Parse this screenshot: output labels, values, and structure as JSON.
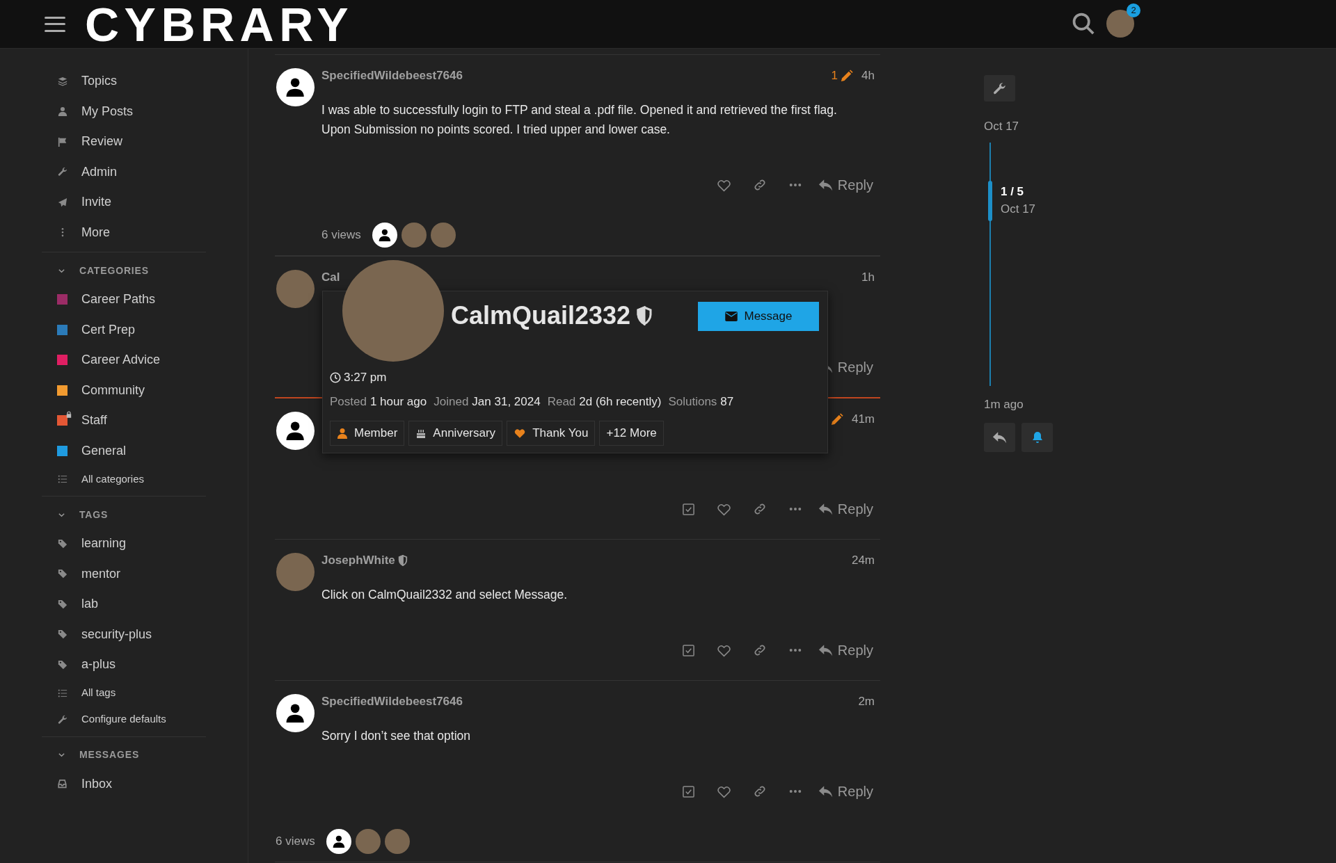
{
  "header": {
    "logo": "CYBRARY",
    "notification_count": "2"
  },
  "sidebar": {
    "nav": [
      {
        "label": "Topics",
        "kind": "topics"
      },
      {
        "label": "My Posts",
        "kind": "user"
      },
      {
        "label": "Review",
        "kind": "flag"
      },
      {
        "label": "Admin",
        "kind": "wrench"
      },
      {
        "label": "Invite",
        "kind": "send"
      },
      {
        "label": "More",
        "kind": "dots"
      }
    ],
    "sections": [
      {
        "title": "CATEGORIES",
        "expanded": true,
        "items": [
          {
            "label": "Career Paths",
            "kind": "category",
            "color": "#9b2c66",
            "locked": false
          },
          {
            "label": "Cert Prep",
            "kind": "category",
            "color": "#2b7bb9",
            "locked": false
          },
          {
            "label": "Career Advice",
            "kind": "category",
            "color": "#e01f63",
            "locked": false
          },
          {
            "label": "Community",
            "kind": "category",
            "color": "#f29b30",
            "locked": false
          },
          {
            "label": "Staff",
            "kind": "category",
            "color": "#e45735",
            "locked": true
          },
          {
            "label": "General",
            "kind": "category",
            "color": "#1f9be0",
            "locked": false
          },
          {
            "label": "All categories",
            "kind": "listing"
          }
        ]
      },
      {
        "title": "TAGS",
        "expanded": true,
        "items": [
          {
            "label": "learning",
            "kind": "tag"
          },
          {
            "label": "mentor",
            "kind": "tag"
          },
          {
            "label": "lab",
            "kind": "tag"
          },
          {
            "label": "security-plus",
            "kind": "tag"
          },
          {
            "label": "a-plus",
            "kind": "tag"
          },
          {
            "label": "All tags",
            "kind": "listing"
          },
          {
            "label": "Configure defaults",
            "kind": "settings"
          }
        ]
      },
      {
        "title": "MESSAGES",
        "expanded": true,
        "items": [
          {
            "label": "Inbox",
            "kind": "inbox"
          }
        ]
      }
    ]
  },
  "stream": [
    {
      "kind": "post",
      "author": "SpecifiedWildebeest7646",
      "has_photo": false,
      "moderator": false,
      "edited": true,
      "edit_count": "1",
      "time": "4h",
      "body": [
        "I was able to successfully login to FTP and steal a .pdf file. Opened it and retrieved the first flag.",
        "Upon Submission no points scored. I tried upper and lower case."
      ],
      "solution_button": false,
      "show_actions": true,
      "reply": "Reply",
      "unread_above": false
    },
    {
      "kind": "views",
      "label": "6 views",
      "inset": true,
      "viewers": [
        {
          "has_photo": false
        },
        {
          "has_photo": true
        },
        {
          "has_photo": true
        }
      ]
    },
    {
      "kind": "post",
      "author": "Cal",
      "has_photo": true,
      "moderator": false,
      "edited": false,
      "time": "1h",
      "solution_button": false,
      "show_actions": false,
      "reply": "Reply",
      "unread_above": false
    },
    {
      "kind": "post",
      "has_photo": false,
      "moderator": false,
      "edited": true,
      "time": "41m",
      "solution_button": true,
      "show_actions": true,
      "reply": "Reply",
      "unread_above": true
    },
    {
      "kind": "post",
      "author": "JosephWhite",
      "has_photo": true,
      "moderator": true,
      "edited": false,
      "time": "24m",
      "body": [
        "Click on CalmQuail2332 and select Message."
      ],
      "solution_button": true,
      "show_actions": true,
      "reply": "Reply",
      "unread_above": false
    },
    {
      "kind": "post",
      "author": "SpecifiedWildebeest7646",
      "has_photo": false,
      "moderator": false,
      "edited": false,
      "time": "2m",
      "body": [
        "Sorry I don’t see that option"
      ],
      "solution_button": true,
      "show_actions": true,
      "reply": "Reply",
      "unread_above": false
    },
    {
      "kind": "views",
      "label": "6 views",
      "inset": false,
      "viewers": [
        {
          "has_photo": false
        },
        {
          "has_photo": true
        },
        {
          "has_photo": true
        }
      ]
    }
  ],
  "user_card": {
    "name": "CalmQuail2332",
    "moderator": true,
    "button": "Message",
    "local_time": "3:27 pm",
    "stats": [
      {
        "label": "Posted",
        "value": "1 hour ago"
      },
      {
        "label": "Joined",
        "value": "Jan 31, 2024"
      },
      {
        "label": "Read",
        "value": "2d (6h recently)"
      },
      {
        "label": "Solutions",
        "value": "87"
      }
    ],
    "badges": [
      {
        "label": "Member",
        "kind": "member"
      },
      {
        "label": "Anniversary",
        "kind": "anniversary"
      },
      {
        "label": "Thank You",
        "kind": "thanks"
      },
      {
        "label": "+12 More",
        "kind": "more"
      }
    ]
  },
  "timeline": {
    "start": "Oct 17",
    "position": "1 / 5",
    "position_date": "Oct 17",
    "end": "1m ago"
  }
}
